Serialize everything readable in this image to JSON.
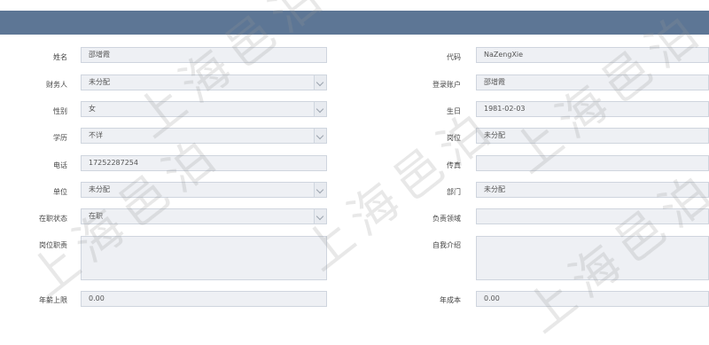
{
  "form": {
    "left": [
      {
        "label": "姓名",
        "value": "邵增霞",
        "type": "text"
      },
      {
        "label": "财务人",
        "value": "未分配",
        "type": "select"
      },
      {
        "label": "性别",
        "value": "女",
        "type": "select"
      },
      {
        "label": "学历",
        "value": "不详",
        "type": "select"
      },
      {
        "label": "电话",
        "value": "17252287254",
        "type": "text"
      },
      {
        "label": "单位",
        "value": "未分配",
        "type": "select"
      },
      {
        "label": "在职状态",
        "value": "在职",
        "type": "select"
      },
      {
        "label": "岗位职责",
        "value": "",
        "type": "textarea"
      },
      {
        "label": "年薪上限",
        "value": "0.00",
        "type": "text"
      }
    ],
    "right": [
      {
        "label": "代码",
        "value": "NaZengXie",
        "type": "text"
      },
      {
        "label": "登录账户",
        "value": "邵增霞",
        "type": "text"
      },
      {
        "label": "生日",
        "value": "1981-02-03",
        "type": "text"
      },
      {
        "label": "岗位",
        "value": "未分配",
        "type": "text"
      },
      {
        "label": "传真",
        "value": "",
        "type": "text"
      },
      {
        "label": "部门",
        "value": "未分配",
        "type": "text"
      },
      {
        "label": "负责领域",
        "value": "",
        "type": "text"
      },
      {
        "label": "自我介绍",
        "value": "",
        "type": "textarea"
      },
      {
        "label": "年成本",
        "value": "0.00",
        "type": "text"
      }
    ]
  },
  "watermark": "上海邑泊",
  "colors": {
    "header": "#5d7695",
    "field_bg": "#eef0f4",
    "field_border": "#cfd5de"
  }
}
